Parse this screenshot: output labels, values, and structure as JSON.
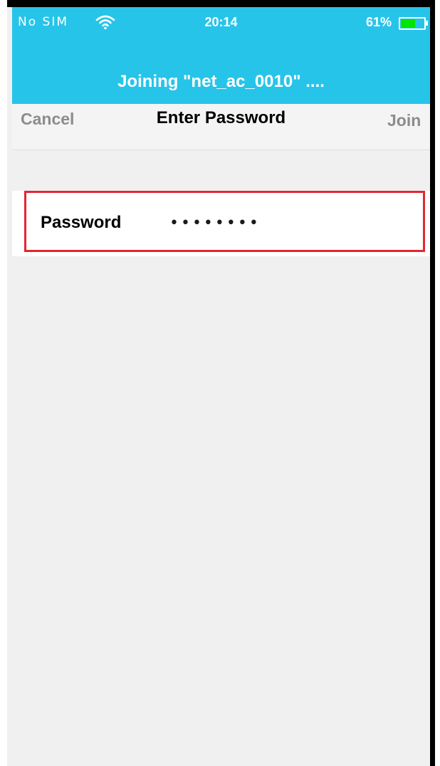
{
  "status_bar": {
    "carrier": "No SIM",
    "time": "20:14",
    "battery_percent": "61%",
    "battery_level": 0.61,
    "wifi_icon": "wifi-icon"
  },
  "header": {
    "title": "Joining \"net_ac_0010\" ...."
  },
  "nav": {
    "cancel_label": "Cancel",
    "title": "Enter Password",
    "join_label": "Join"
  },
  "form": {
    "password_label": "Password",
    "password_value": "••••••••"
  },
  "colors": {
    "accent": "#27c4e9",
    "highlight": "#e32631",
    "battery": "#00e600"
  }
}
